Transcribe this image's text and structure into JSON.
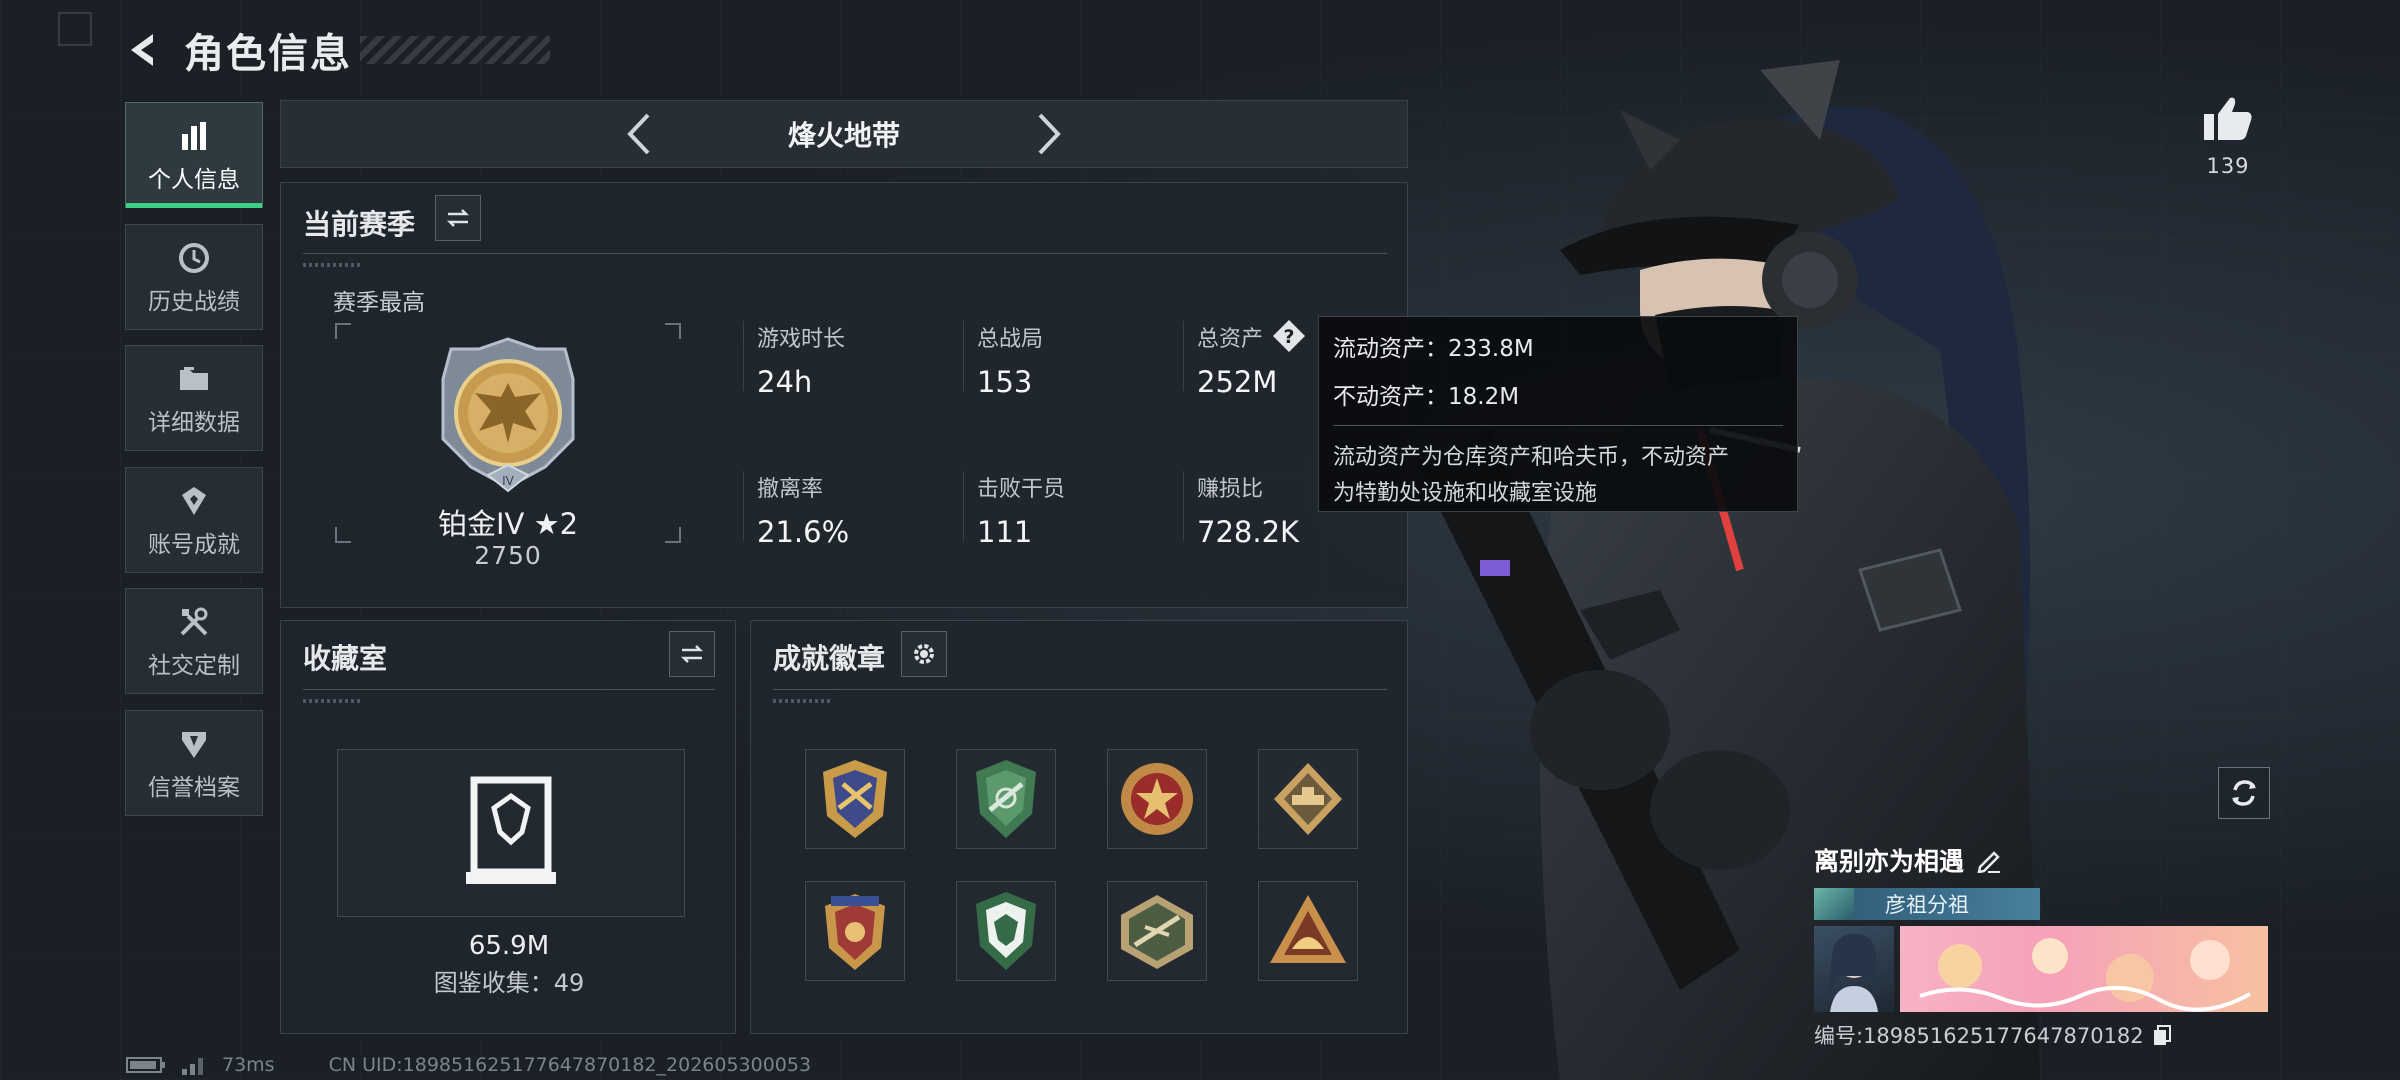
{
  "header": {
    "title": "角色信息"
  },
  "sidebar": {
    "items": [
      {
        "label": "个人信息",
        "icon": "bar-chart-icon",
        "active": true
      },
      {
        "label": "历史战绩",
        "icon": "history-icon",
        "active": false
      },
      {
        "label": "详细数据",
        "icon": "folder-icon",
        "active": false
      },
      {
        "label": "账号成就",
        "icon": "achievement-icon",
        "active": false
      },
      {
        "label": "社交定制",
        "icon": "tools-icon",
        "active": false
      },
      {
        "label": "信誉档案",
        "icon": "credit-icon",
        "active": false
      }
    ]
  },
  "mode_selector": {
    "current": "烽火地带"
  },
  "season": {
    "title": "当前赛季",
    "best_caption": "赛季最高",
    "rank_name": "铂金IV ★2",
    "rank_score": "2750",
    "stats": [
      {
        "label": "游戏时长",
        "value": "24h"
      },
      {
        "label": "总战局",
        "value": "153"
      },
      {
        "label": "总资产",
        "value": "252M"
      },
      {
        "label": "撤离率",
        "value": "21.6%"
      },
      {
        "label": "击败干员",
        "value": "111"
      },
      {
        "label": "赚损比",
        "value": "728.2K"
      }
    ]
  },
  "tooltip": {
    "liquid": "流动资产：233.8M",
    "fixed": "不动资产：18.2M",
    "desc_line1": "流动资产为仓库资产和哈夫币，不动资产",
    "desc_line2": "为特勤处设施和收藏室设施"
  },
  "collection": {
    "title": "收藏室",
    "value": "65.9M",
    "count": "图鉴收集：49"
  },
  "achievements": {
    "title": "成就徽章",
    "badges": [
      "badge-1",
      "badge-2",
      "badge-3",
      "badge-4",
      "badge-5",
      "badge-6",
      "badge-7",
      "badge-8"
    ]
  },
  "likes": {
    "count": "139"
  },
  "player": {
    "name": "离别亦为相遇",
    "tag": "彦祖分祖",
    "id": "编号:1898516251776478701​82"
  },
  "footer": {
    "ping": "73ms",
    "uid": "CN UID:18985162517764787018​2_202605300053"
  },
  "colors": {
    "accent": "#3ed087",
    "panel": "#20262d",
    "gold": "#c9a25a"
  }
}
